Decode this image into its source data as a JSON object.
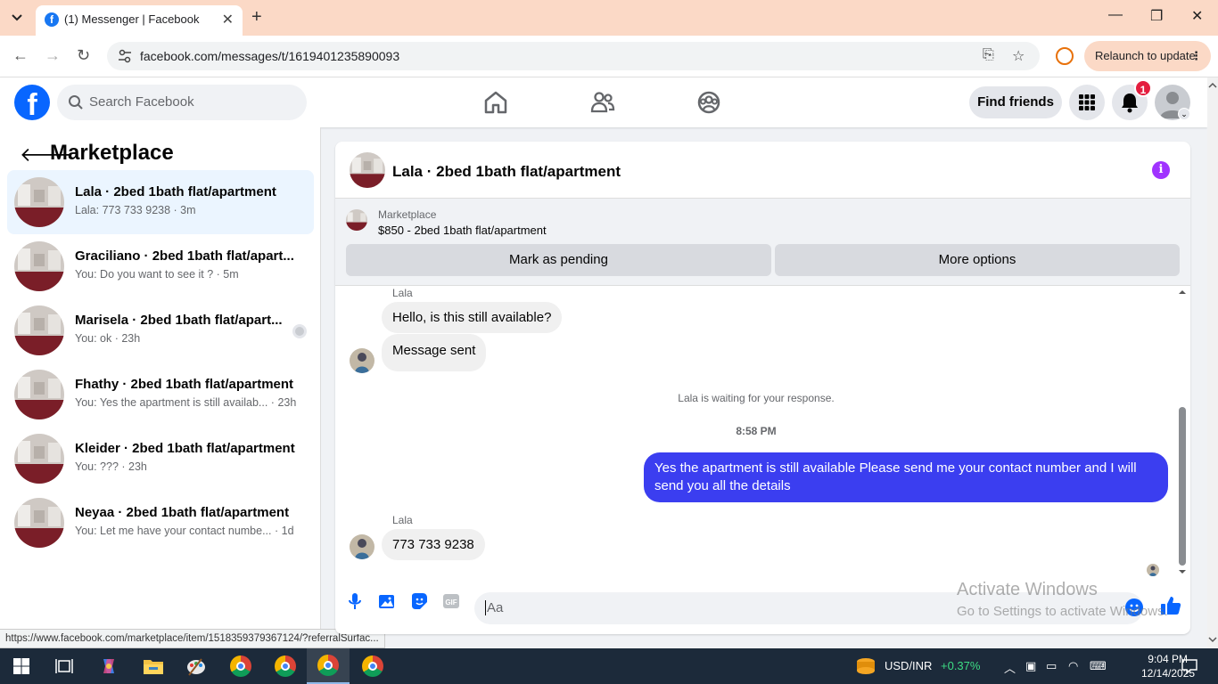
{
  "browser": {
    "tab_title": "(1) Messenger | Facebook",
    "url": "facebook.com/messages/t/1619401235890093",
    "relaunch_label": "Relaunch to update",
    "status_url": "https://www.facebook.com/marketplace/item/1518359379367124/?referralSurfac..."
  },
  "fb_header": {
    "search_placeholder": "Search Facebook",
    "find_friends": "Find friends",
    "notification_count": "1"
  },
  "sidebar": {
    "title": "Marketplace",
    "threads": [
      {
        "name": "Lala · 2bed 1bath flat/apartment",
        "sub": "Lala: 773 733 9238 · 3m"
      },
      {
        "name": "Graciliano · 2bed 1bath flat/apart...",
        "sub": "You: Do you want to see it ? · 5m"
      },
      {
        "name": "Marisela · 2bed 1bath flat/apart...",
        "sub": "You: ok · 23h"
      },
      {
        "name": "Fhathy · 2bed 1bath flat/apartment",
        "sub": "You: Yes the apartment is still availab... · 23h"
      },
      {
        "name": "Kleider · 2bed 1bath flat/apartment",
        "sub": "You: ??? · 23h"
      },
      {
        "name": "Neyaa · 2bed 1bath flat/apartment",
        "sub": "You: Let me have your contact numbe... · 1d"
      }
    ]
  },
  "chat": {
    "title": "Lala · 2bed 1bath flat/apartment",
    "marketplace_label": "Marketplace",
    "listing": "$850 - 2bed 1bath flat/apartment",
    "mark_pending": "Mark as pending",
    "more_options": "More options",
    "sender1": "Lala",
    "msg1": "Hello, is this still available?",
    "msg2": "Message sent",
    "waiting_note": "Lala is waiting for your response.",
    "time": "8:58 PM",
    "my_msg": "Yes the apartment is still available Please send me your contact number and I will send you all the details",
    "sender2": "Lala",
    "msg3": "773 733 9238",
    "input_placeholder": "Aa"
  },
  "watermark": {
    "line1": "Activate Windows",
    "line2": "Go to Settings to activate Windows."
  },
  "taskbar": {
    "ticker": "USD/INR",
    "ticker_change": "+0.37%",
    "time": "9:04 PM",
    "date": "12/14/2025"
  },
  "colors": {
    "fb_blue": "#0866ff",
    "my_bubble": "#3b3ef0",
    "info_purple": "#a033ff",
    "badge_red": "#e41e3f"
  }
}
